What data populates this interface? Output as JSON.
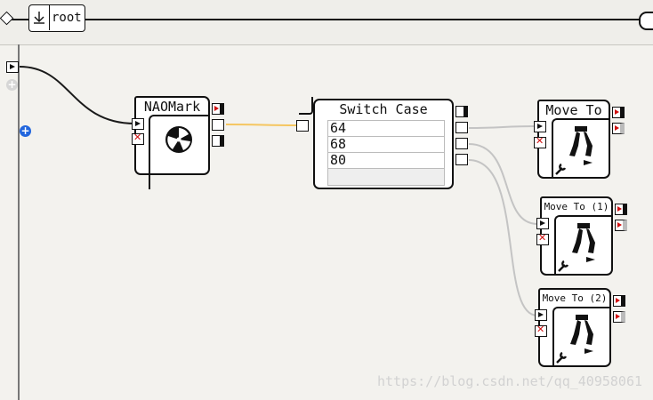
{
  "breadcrumb": {
    "label": "root"
  },
  "boxes": {
    "naomark": {
      "title": "NAOMark"
    },
    "switch_case": {
      "title": "Switch Case",
      "cases": [
        "64",
        "68",
        "80"
      ]
    },
    "move_to": {
      "title": "Move To"
    },
    "move_to_1": {
      "title": "Move To (1)"
    },
    "move_to_2": {
      "title": "Move To (2)"
    }
  },
  "watermark": "https://blog.csdn.net/qq_40958061",
  "colors": {
    "background": "#f3f2ee",
    "link_active": "#f5c660",
    "link_idle": "#c4c4c4",
    "stop_red": "#d01010"
  }
}
